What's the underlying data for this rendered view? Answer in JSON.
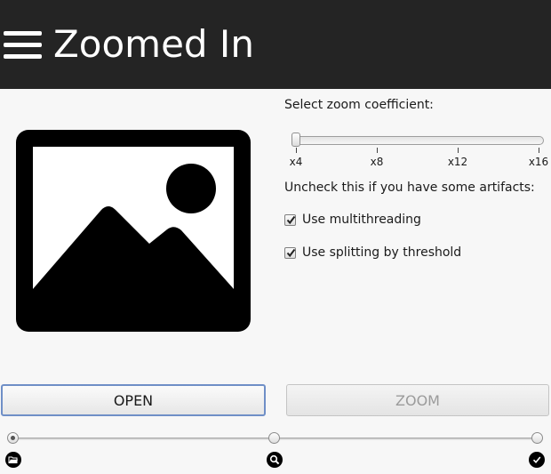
{
  "header": {
    "title": "Zoomed In",
    "menu_icon": "hamburger-menu-icon"
  },
  "preview": {
    "icon": "image-placeholder-icon"
  },
  "zoom": {
    "label": "Select zoom coefficient:",
    "ticks": [
      "x4",
      "x8",
      "x12",
      "x16"
    ],
    "value": "x4"
  },
  "artifacts": {
    "label": "Uncheck this if you have some artifacts:",
    "multithreading": {
      "label": "Use multithreading",
      "checked": true
    },
    "splitting": {
      "label": "Use splitting by threshold",
      "checked": true
    }
  },
  "buttons": {
    "open": "OPEN",
    "zoom": "ZOOM",
    "zoom_enabled": false
  },
  "steps": {
    "items": [
      {
        "icon": "folder-open-icon",
        "active": true
      },
      {
        "icon": "magnifier-icon",
        "active": false
      },
      {
        "icon": "checkmark-icon",
        "active": false
      }
    ]
  },
  "colors": {
    "header_bg": "#242424",
    "background": "#f7f7f7",
    "focus_border": "#6f8fc7"
  }
}
